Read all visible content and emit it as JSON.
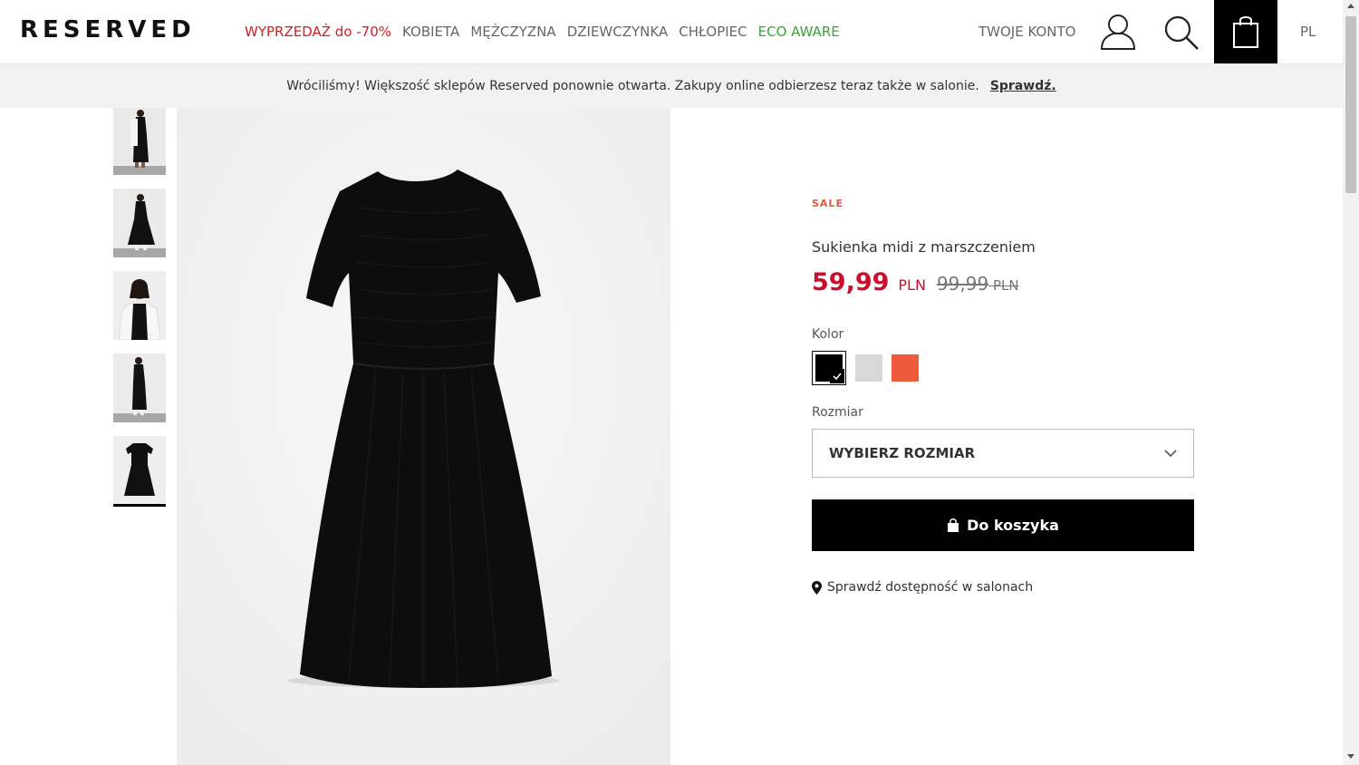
{
  "header": {
    "logo": "RESERVED",
    "nav": [
      {
        "label": "WYPRZEDAŻ do -70%",
        "style": "sale"
      },
      {
        "label": "KOBIETA",
        "style": "normal"
      },
      {
        "label": "MĘŻCZYZNA",
        "style": "normal"
      },
      {
        "label": "DZIEWCZYNKA",
        "style": "normal"
      },
      {
        "label": "CHŁOPIEC",
        "style": "normal"
      },
      {
        "label": "ECO AWARE",
        "style": "eco"
      }
    ],
    "account_label": "TWOJE KONTO",
    "lang": "PL"
  },
  "banner": {
    "text": "Wróciliśmy! Większość sklepów Reserved ponownie otwarta. Zakupy online odbierzesz teraz także w salonie.",
    "link": "Sprawdź."
  },
  "gallery": {
    "thumbnail_count": 5,
    "active_thumbnail": 5
  },
  "product": {
    "badge": "SALE",
    "name": "Sukienka midi z marszczeniem",
    "price_new": "59,99",
    "currency_new": "PLN",
    "price_old": "99,99",
    "currency_old": "PLN",
    "color_label": "Kolor",
    "colors": [
      "#000000",
      "#d8d8d8",
      "#f05a3c"
    ],
    "selected_color": 0,
    "size_label": "Rozmiar",
    "size_placeholder": "WYBIERZ ROZMIAR",
    "add_to_cart": "Do koszyka",
    "availability": "Sprawdź dostępność w salonach"
  },
  "colors": {
    "sale_red": "#d21f1f",
    "eco_green": "#3aa33a",
    "price_red": "#c8102e",
    "badge_orange": "#e05a3a"
  }
}
